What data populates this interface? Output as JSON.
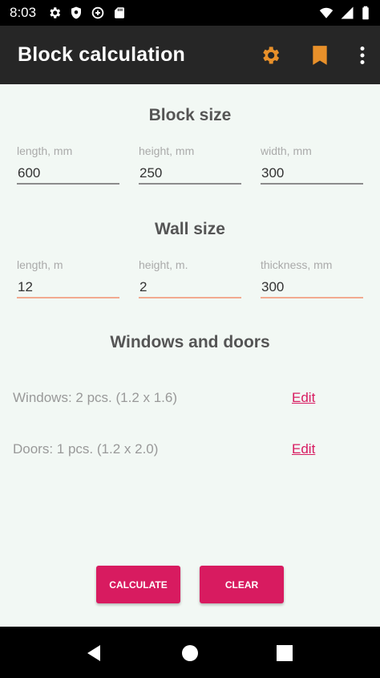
{
  "status_bar": {
    "time": "8:03"
  },
  "app_bar": {
    "title": "Block calculation",
    "accent_color": "#e8902a",
    "icons": [
      "gear-icon",
      "bookmark-icon",
      "more-vert-icon"
    ]
  },
  "block_size": {
    "title": "Block size",
    "fields": [
      {
        "label": "length, mm",
        "value": "600"
      },
      {
        "label": "height, mm",
        "value": "250"
      },
      {
        "label": "width, mm",
        "value": "300"
      }
    ]
  },
  "wall_size": {
    "title": "Wall size",
    "fields": [
      {
        "label": "length, m",
        "value": "12"
      },
      {
        "label": "height, m.",
        "value": "2"
      },
      {
        "label": "thickness, mm",
        "value": "300"
      }
    ]
  },
  "windows_doors": {
    "title": "Windows and doors",
    "windows": {
      "text": "Windows: 2 pcs. (1.2 x 1.6)",
      "edit": "Edit"
    },
    "doors": {
      "text": "Doors: 1 pcs. (1.2 x 2.0)",
      "edit": "Edit"
    }
  },
  "actions": {
    "calculate": "CALCULATE",
    "clear": "CLEAR",
    "color": "#d81b60"
  }
}
